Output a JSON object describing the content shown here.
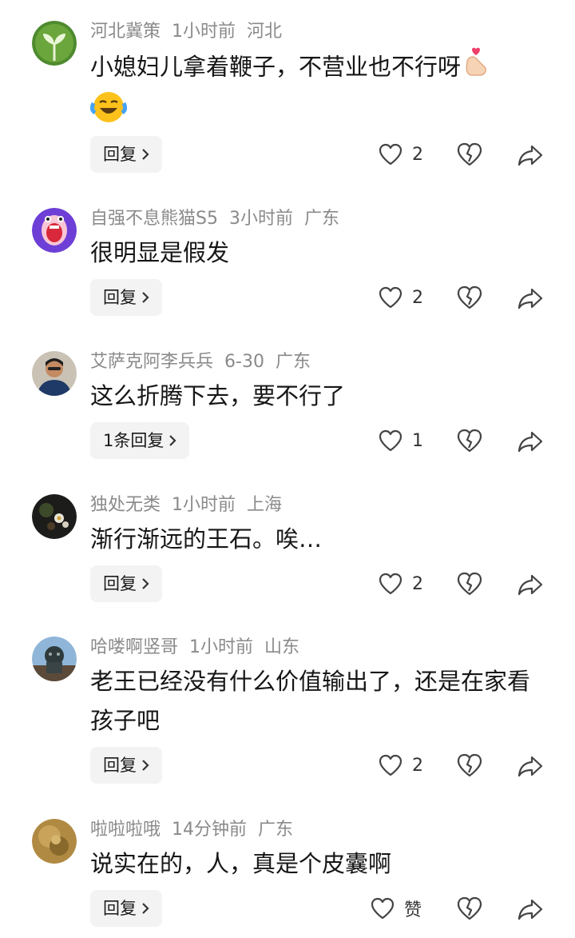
{
  "comments": [
    {
      "username": "河北冀策",
      "time": "1小时前",
      "location": "河北",
      "text": "小媳妇儿拿着鞭子，不营业也不行呀",
      "reply_label": "回复",
      "likes": "2",
      "avatar_icon": "sprout-icon",
      "emojis": [
        "finger-heart-emoji",
        "laughing-tears-emoji"
      ]
    },
    {
      "username": "自强不息熊猫S5",
      "time": "3小时前",
      "location": "广东",
      "text": "很明显是假发",
      "reply_label": "回复",
      "likes": "2",
      "avatar_icon": "screaming-cartoon-icon"
    },
    {
      "username": "艾萨克阿李兵兵",
      "time": "6-30",
      "location": "广东",
      "text": "这么折腾下去，要不行了",
      "reply_label": "1条回复",
      "likes": "1",
      "avatar_icon": "man-photo-icon"
    },
    {
      "username": "独处无类",
      "time": "1小时前",
      "location": "上海",
      "text": "渐行渐远的王石。唉…",
      "reply_label": "回复",
      "likes": "2",
      "avatar_icon": "flower-photo-icon"
    },
    {
      "username": "哈喽啊竖哥",
      "time": "1小时前",
      "location": "山东",
      "text": "老王已经没有什么价值输出了，还是在家看孩子吧",
      "reply_label": "回复",
      "likes": "2",
      "avatar_icon": "lion-statue-icon"
    },
    {
      "username": "啦啦啦哦",
      "time": "14分钟前",
      "location": "广东",
      "text": "说实在的，人，真是个皮囊啊",
      "reply_label": "回复",
      "likes": "赞",
      "avatar_icon": "golden-texture-icon"
    }
  ]
}
